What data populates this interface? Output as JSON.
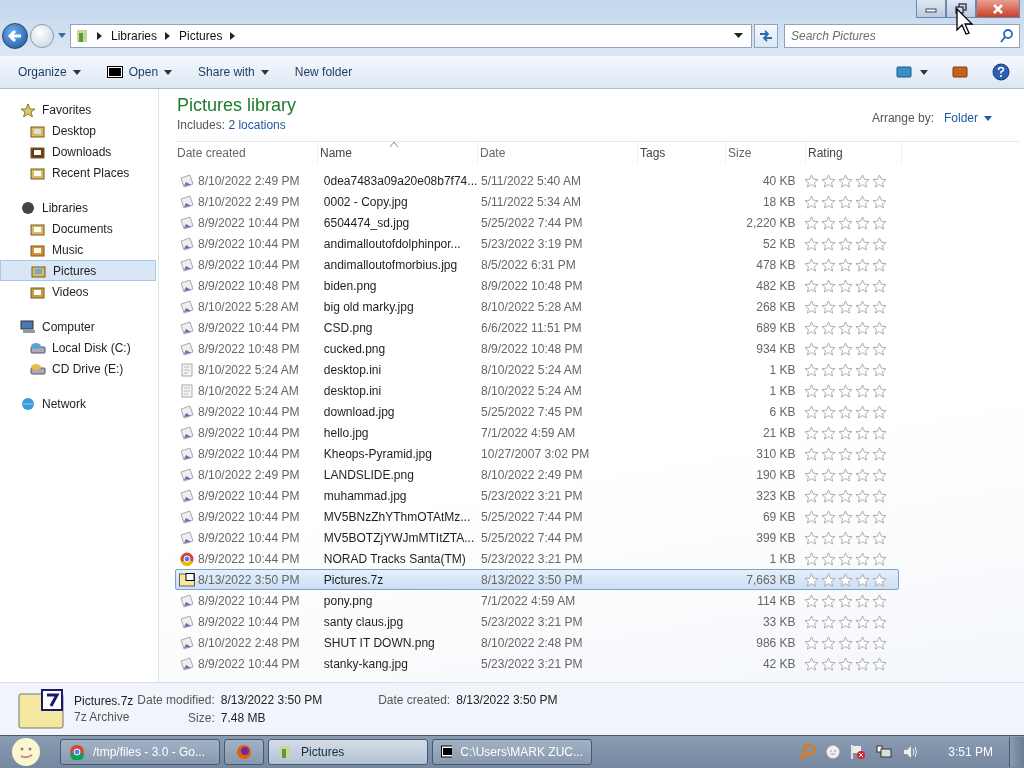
{
  "address": {
    "crumbs": [
      "Libraries",
      "Pictures"
    ]
  },
  "search": {
    "placeholder": "Search Pictures"
  },
  "toolbar": {
    "buttons": [
      {
        "label": "Organize",
        "kind": "menu"
      },
      {
        "label": "Open",
        "kind": "open"
      },
      {
        "label": "Share with",
        "kind": "menu"
      },
      {
        "label": "New folder",
        "kind": "plain"
      }
    ]
  },
  "sidebar": {
    "groups": [
      {
        "label": "Favorites",
        "kind": "favorites",
        "selected": false,
        "children": [
          {
            "label": "Desktop",
            "kind": "desktop",
            "selected": false
          },
          {
            "label": "Downloads",
            "kind": "downloads",
            "selected": false
          },
          {
            "label": "Recent Places",
            "kind": "recent",
            "selected": false
          }
        ]
      },
      {
        "label": "Libraries",
        "kind": "libraries",
        "selected": false,
        "children": [
          {
            "label": "Documents",
            "kind": "documents",
            "selected": false
          },
          {
            "label": "Music",
            "kind": "music",
            "selected": false
          },
          {
            "label": "Pictures",
            "kind": "pictures",
            "selected": true
          },
          {
            "label": "Videos",
            "kind": "videos",
            "selected": false
          }
        ]
      },
      {
        "label": "Computer",
        "kind": "computer",
        "selected": false,
        "children": [
          {
            "label": "Local Disk (C:)",
            "kind": "disk",
            "selected": false
          },
          {
            "label": "CD Drive (E:)",
            "kind": "cd",
            "selected": false
          }
        ]
      },
      {
        "label": "Network",
        "kind": "network",
        "selected": false
      }
    ]
  },
  "library": {
    "title": "Pictures library",
    "includes_label": "Includes:",
    "includes_link": "2 locations",
    "arrange_label": "Arrange by:",
    "arrange_value": "Folder"
  },
  "table": {
    "columns": [
      "Date created",
      "Name",
      "Date",
      "Tags",
      "Size",
      "Rating"
    ],
    "rows": [
      {
        "kind": "image",
        "created": "8/10/2022 2:49 PM",
        "name": "0dea7483a09a20e08b7f74...",
        "date": "5/11/2022 5:40 AM",
        "size": "40 KB",
        "stars": 0,
        "selected": false
      },
      {
        "kind": "image",
        "created": "8/10/2022 2:49 PM",
        "name": "0002 - Copy.jpg",
        "date": "5/11/2022 5:34 AM",
        "size": "18 KB",
        "stars": 0,
        "selected": false
      },
      {
        "kind": "image",
        "created": "8/9/2022 10:44 PM",
        "name": "6504474_sd.jpg",
        "date": "5/25/2022 7:44 PM",
        "size": "2,220 KB",
        "stars": 0,
        "selected": false
      },
      {
        "kind": "image",
        "created": "8/9/2022 10:44 PM",
        "name": "andimalloutofdolphinpor...",
        "date": "5/23/2022 3:19 PM",
        "size": "52 KB",
        "stars": 0,
        "selected": false
      },
      {
        "kind": "image",
        "created": "8/9/2022 10:44 PM",
        "name": "andimalloutofmorbius.jpg",
        "date": "8/5/2022 6:31 PM",
        "size": "478 KB",
        "stars": 0,
        "selected": false
      },
      {
        "kind": "image",
        "created": "8/9/2022 10:48 PM",
        "name": "biden.png",
        "date": "8/9/2022 10:48 PM",
        "size": "482 KB",
        "stars": 0,
        "selected": false
      },
      {
        "kind": "image",
        "created": "8/10/2022 5:28 AM",
        "name": "big old marky.jpg",
        "date": "8/10/2022 5:28 AM",
        "size": "268 KB",
        "stars": 0,
        "selected": false
      },
      {
        "kind": "image",
        "created": "8/9/2022 10:44 PM",
        "name": "CSD.png",
        "date": "6/6/2022 11:51 PM",
        "size": "689 KB",
        "stars": 0,
        "selected": false
      },
      {
        "kind": "image",
        "created": "8/9/2022 10:48 PM",
        "name": "cucked.png",
        "date": "8/9/2022 10:48 PM",
        "size": "934 KB",
        "stars": 0,
        "selected": false
      },
      {
        "kind": "settings",
        "created": "8/10/2022 5:24 AM",
        "name": "desktop.ini",
        "date": "8/10/2022 5:24 AM",
        "size": "1 KB",
        "stars": 0,
        "selected": false
      },
      {
        "kind": "settings",
        "created": "8/10/2022 5:24 AM",
        "name": "desktop.ini",
        "date": "8/10/2022 5:24 AM",
        "size": "1 KB",
        "stars": 0,
        "selected": false
      },
      {
        "kind": "image",
        "created": "8/9/2022 10:44 PM",
        "name": "download.jpg",
        "date": "5/25/2022 7:45 PM",
        "size": "6 KB",
        "stars": 0,
        "selected": false
      },
      {
        "kind": "image",
        "created": "8/9/2022 10:44 PM",
        "name": "hello.jpg",
        "date": "7/1/2022 4:59 AM",
        "size": "21 KB",
        "stars": 0,
        "selected": false
      },
      {
        "kind": "image",
        "created": "8/9/2022 10:44 PM",
        "name": "Kheops-Pyramid.jpg",
        "date": "10/27/2007 3:02 PM",
        "size": "310 KB",
        "stars": 0,
        "selected": false
      },
      {
        "kind": "image",
        "created": "8/10/2022 2:49 PM",
        "name": "LANDSLIDE.png",
        "date": "8/10/2022 2:49 PM",
        "size": "190 KB",
        "stars": 0,
        "selected": false
      },
      {
        "kind": "image",
        "created": "8/9/2022 10:44 PM",
        "name": "muhammad.jpg",
        "date": "5/23/2022 3:21 PM",
        "size": "323 KB",
        "stars": 0,
        "selected": false
      },
      {
        "kind": "image",
        "created": "8/9/2022 10:44 PM",
        "name": "MV5BNzZhYThmOTAtMz...",
        "date": "5/25/2022 7:44 PM",
        "size": "69 KB",
        "stars": 0,
        "selected": false
      },
      {
        "kind": "image",
        "created": "8/9/2022 10:44 PM",
        "name": "MV5BOTZjYWJmMTItZTA...",
        "date": "5/25/2022 7:44 PM",
        "size": "399 KB",
        "stars": 0,
        "selected": false
      },
      {
        "kind": "web",
        "created": "8/9/2022 10:44 PM",
        "name": "NORAD Tracks Santa(TM)",
        "date": "5/23/2022 3:21 PM",
        "size": "1 KB",
        "stars": 0,
        "selected": false
      },
      {
        "kind": "archive",
        "created": "8/13/2022 3:50 PM",
        "name": "Pictures.7z",
        "date": "8/13/2022 3:50 PM",
        "size": "7,663 KB",
        "stars": 0,
        "selected": true
      },
      {
        "kind": "image",
        "created": "8/9/2022 10:44 PM",
        "name": "pony.png",
        "date": "7/1/2022 4:59 AM",
        "size": "114 KB",
        "stars": 0,
        "selected": false
      },
      {
        "kind": "image",
        "created": "8/9/2022 10:44 PM",
        "name": "santy claus.jpg",
        "date": "5/23/2022 3:21 PM",
        "size": "33 KB",
        "stars": 0,
        "selected": false
      },
      {
        "kind": "image",
        "created": "8/10/2022 2:48 PM",
        "name": "SHUT IT DOWN.png",
        "date": "8/10/2022 2:48 PM",
        "size": "986 KB",
        "stars": 0,
        "selected": false
      },
      {
        "kind": "image",
        "created": "8/9/2022 10:44 PM",
        "name": "stanky-kang.jpg",
        "date": "5/23/2022 3:21 PM",
        "size": "42 KB",
        "stars": 0,
        "selected": false
      }
    ]
  },
  "details": {
    "name": "Pictures.7z",
    "type": "7z Archive",
    "fields": [
      {
        "label": "Date modified:",
        "value": "8/13/2022 3:50 PM"
      },
      {
        "label": "Date created:",
        "value": "8/13/2022 3:50 PM"
      },
      {
        "label": "Size:",
        "value": "7.48 MB"
      }
    ]
  },
  "taskbar": {
    "buttons": [
      {
        "label": "/tmp/files - 3.0 - Go...",
        "kind": "browser",
        "selected": false
      },
      {
        "kind": "firefox",
        "selected": false
      },
      {
        "label": "Pictures",
        "kind": "explorer",
        "selected": true
      },
      {
        "label": "C:\\Users\\MARK ZUC...",
        "kind": "archiver",
        "selected": false
      }
    ],
    "clock": "3:51 PM"
  }
}
